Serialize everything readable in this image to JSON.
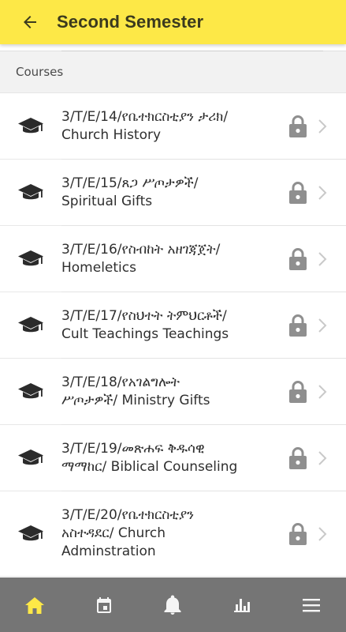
{
  "appbar": {
    "title": "Second Semester",
    "back_icon": "arrow-left-icon",
    "background": "#fde847"
  },
  "section": {
    "label": "Courses"
  },
  "courses": [
    {
      "line1": "3/T/E/14/የቤተክርስቲያን ታሪክ/",
      "line2": "Church History",
      "line3": "",
      "status_icon": "lock-icon"
    },
    {
      "line1": "3/T/E/15/ጸጋ ሥጦታዎች/",
      "line2": "Spiritual Gifts",
      "line3": "",
      "status_icon": "lock-icon"
    },
    {
      "line1": "3/T/E/16/የስብከት አዘገጃጀት/",
      "line2": "Homeletics",
      "line3": "",
      "status_icon": "lock-icon"
    },
    {
      "line1": "3/T/E/17/የስህተት ትምህርቶች/",
      "line2": "Cult Teachings Teachings",
      "line3": "",
      "status_icon": "lock-icon"
    },
    {
      "line1": "3/T/E/18/የአገልግሎት",
      "line2": "ሥጦታዎች/ Ministry Gifts",
      "line3": "",
      "status_icon": "lock-icon"
    },
    {
      "line1": "3/T/E/19/መጽሐፍ ቅዱሳዊ",
      "line2": "ማማከር/ Biblical Counseling",
      "line3": "",
      "status_icon": "lock-icon"
    },
    {
      "line1": "3/T/E/20/የቤተክርስቲያን",
      "line2": "አስተዳደር/ Church",
      "line3": "Adminstration",
      "status_icon": "lock-icon"
    }
  ],
  "bottom_nav": {
    "background": "#757575",
    "active_color": "#fde847",
    "items": [
      {
        "icon": "home-icon",
        "active": true
      },
      {
        "icon": "calendar-icon",
        "active": false
      },
      {
        "icon": "bell-icon",
        "active": false
      },
      {
        "icon": "bar-chart-icon",
        "active": false
      },
      {
        "icon": "menu-icon",
        "active": false
      }
    ]
  }
}
